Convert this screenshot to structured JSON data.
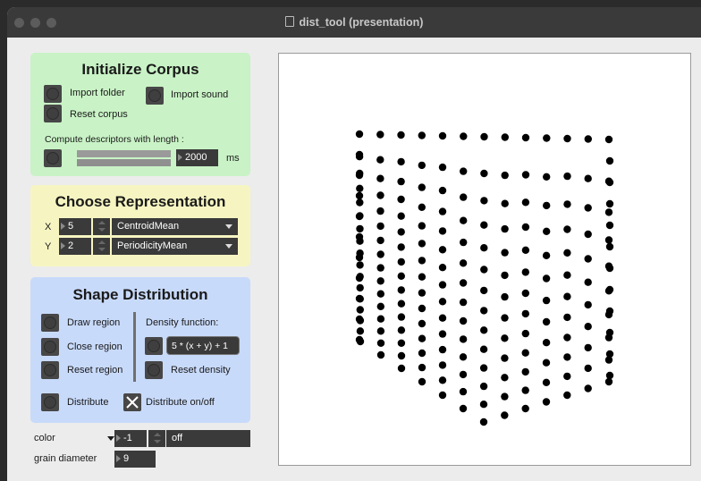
{
  "window": {
    "title": "dist_tool (presentation)"
  },
  "init_corpus": {
    "title": "Initialize Corpus",
    "import_folder": "Import folder",
    "import_sound": "Import sound",
    "reset_corpus": "Reset corpus",
    "compute_label": "Compute descriptors with length :",
    "length_value": "2000",
    "length_unit": "ms"
  },
  "representation": {
    "title": "Choose Representation",
    "x_label": "X",
    "x_value": "5",
    "x_descriptor": "CentroidMean",
    "y_label": "Y",
    "y_value": "2",
    "y_descriptor": "PeriodicityMean"
  },
  "shape": {
    "title": "Shape Distribution",
    "draw_region": "Draw region",
    "close_region": "Close region",
    "reset_region": "Reset region",
    "density_label": "Density function:",
    "density_expression": "5 * (x + y) + 1",
    "reset_density": "Reset density",
    "distribute": "Distribute",
    "distribute_toggle": "Distribute on/off",
    "distribute_toggle_checked": true
  },
  "footer": {
    "color_menu": "color",
    "color_value": "-1",
    "color_mode": "off",
    "grain_label": "grain diameter",
    "grain_value": "9"
  },
  "display": {
    "point_color": "#000000",
    "background": "#ffffff"
  }
}
